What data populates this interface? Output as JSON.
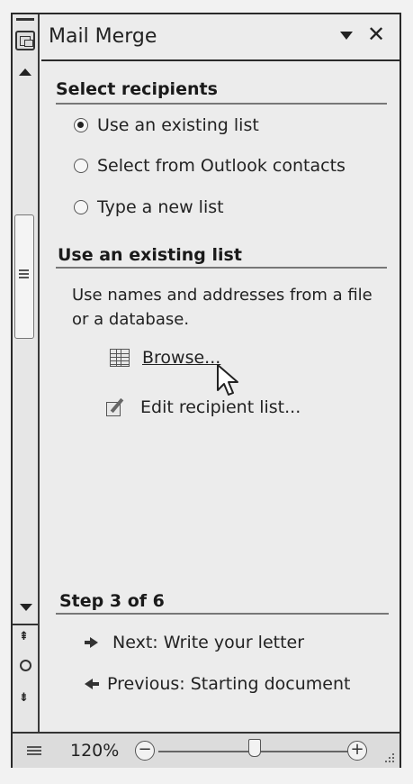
{
  "pane": {
    "title": "Mail Merge",
    "close_label": "✕"
  },
  "select_recipients": {
    "heading": "Select recipients",
    "options": [
      {
        "label": "Use an existing list",
        "selected": true
      },
      {
        "label": "Select from Outlook contacts",
        "selected": false
      },
      {
        "label": "Type a new list",
        "selected": false
      }
    ]
  },
  "existing_list": {
    "heading": "Use an existing list",
    "description": "Use names and addresses from a file or a database.",
    "browse_label": "Browse...",
    "edit_label": "Edit recipient list..."
  },
  "step": {
    "heading": "Step 3 of 6",
    "next_label": "Next: Write your letter",
    "previous_label": "Previous: Starting document"
  },
  "statusbar": {
    "zoom_level": "120%",
    "zoom_out_label": "−",
    "zoom_in_label": "+"
  }
}
